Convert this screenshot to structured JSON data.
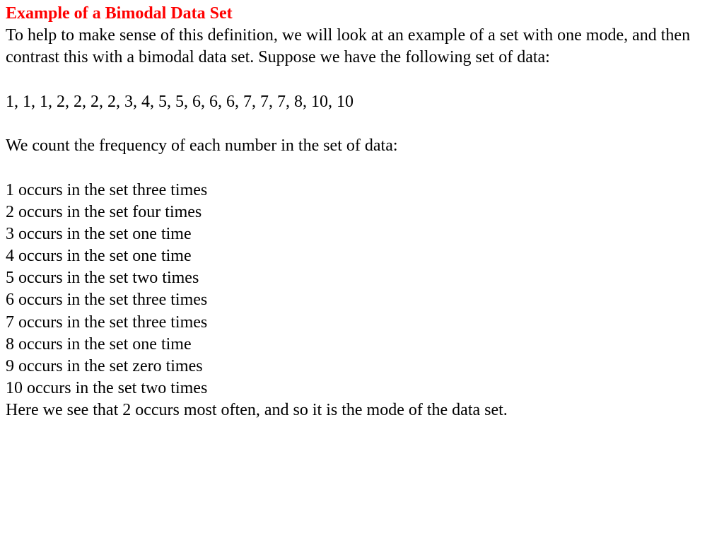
{
  "heading": "Example of a Bimodal Data Set",
  "intro": "To help to make sense of this definition, we will look at an example of a set with one mode, and then contrast this with a bimodal data set. Suppose we have the following set of data:",
  "data_set": "1, 1, 1, 2, 2, 2, 2, 3, 4, 5, 5, 6, 6, 6, 7, 7, 7, 8, 10, 10",
  "count_intro": "We count the frequency of each number in the set of data:",
  "frequencies": [
    "1 occurs in the set three times",
    "2 occurs in the set four times",
    "3 occurs in the set one time",
    "4 occurs in the set one time",
    "5 occurs in the set two times",
    "6 occurs in the set three times",
    "7 occurs in the set three times",
    "8 occurs in the set one time",
    "9 occurs in the set zero times",
    "10 occurs in the set two times"
  ],
  "conclusion": "Here we see that 2 occurs most often, and so it is the mode of the data set."
}
